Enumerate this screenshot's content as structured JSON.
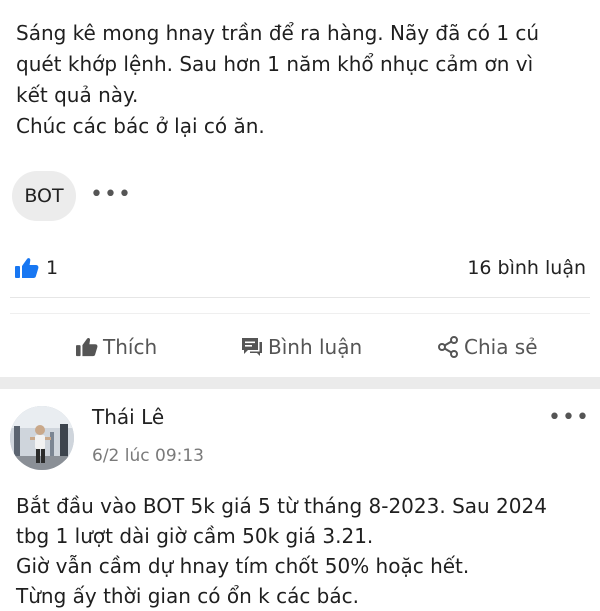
{
  "post1": {
    "lines": [
      "Sáng kê mong hnay trần để ra hàng. Nãy đã có 1 cú",
      "quét khớp lệnh. Sau hơn 1 năm khổ nhục cảm ơn vì",
      "kết quả này.",
      "Chúc các bác ở lại có ăn."
    ],
    "tag": "BOT",
    "more": "•••",
    "like_count": "1",
    "comment_count": "16 bình luận",
    "actions": {
      "like": "Thích",
      "comment": "Bình luận",
      "share": "Chia sẻ"
    }
  },
  "post2": {
    "author": "Thái Lê",
    "time": "6/2 lúc 09:13",
    "menu": "•••",
    "lines": [
      "Bắt đầu vào BOT 5k giá 5 từ tháng 8-2023. Sau 2024",
      "tbg 1 lượt dài giờ cầm 50k giá 3.21.",
      "Giờ vẫn cầm dự hnay tím chốt 50% hoặc hết.",
      "Từng ấy thời gian có ổn k các bác."
    ]
  },
  "colors": {
    "like_blue": "#1877f2",
    "icon_grey": "#555555",
    "separator": "#ebebeb"
  },
  "icons": {
    "like_reaction": "thumbs-up-icon",
    "like_action": "thumbs-up-icon",
    "comment_action": "comment-icon",
    "share_action": "share-icon",
    "more": "more-dots-icon"
  }
}
